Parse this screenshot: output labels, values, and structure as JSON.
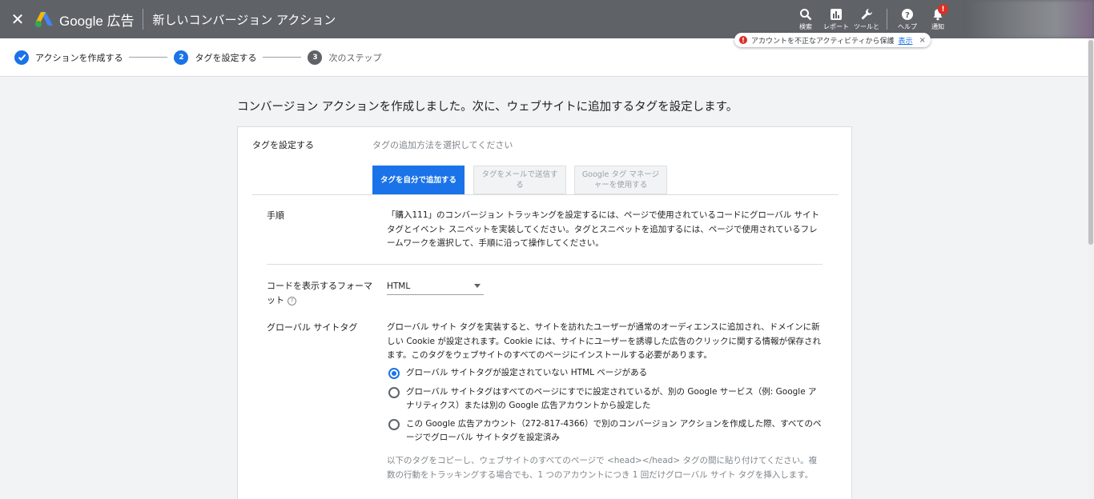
{
  "topbar": {
    "brand": "Google 広告",
    "page_title": "新しいコンバージョン アクション",
    "buttons": [
      {
        "label": "検索",
        "icon": "search-icon"
      },
      {
        "label": "レポート",
        "icon": "reports-icon"
      },
      {
        "label": "ツールと",
        "icon": "wrench-icon"
      },
      {
        "label": "ヘルプ",
        "icon": "help-icon"
      },
      {
        "label": "通知",
        "icon": "bell-icon"
      }
    ],
    "notification_badge": "!"
  },
  "toast": {
    "text": "アカウントを不正なアクティビティから保護",
    "link": "表示",
    "close": "×"
  },
  "stepper": {
    "steps": [
      {
        "number": "",
        "label": "アクションを作成する",
        "state": "done"
      },
      {
        "number": "2",
        "label": "タグを設定する",
        "state": "active"
      },
      {
        "number": "3",
        "label": "次のステップ",
        "state": "pending"
      }
    ]
  },
  "main": {
    "heading": "コンバージョン アクションを作成しました。次に、ウェブサイトに追加するタグを設定します。",
    "card": {
      "label": "タグを設定する",
      "subtitle": "タグの追加方法を選択してください",
      "tabs": [
        {
          "label": "タグを自分で追加する",
          "active": true
        },
        {
          "label": "タグをメールで送信する",
          "active": false
        },
        {
          "label": "Google タグ マネージャーを使用する",
          "active": false
        }
      ],
      "steps_label": "手順",
      "steps_text": "「購入111」のコンバージョン トラッキングを設定するには、ページで使用されているコードにグローバル サイトタグとイベント スニペットを実装してください。タグとスニペットを追加するには、ページで使用されているフレームワークを選択して、手順に沿って操作してください。",
      "format_label": "コードを表示するフォーマット",
      "format_value": "HTML",
      "global_tag_label": "グローバル サイトタグ",
      "global_tag_text": "グローバル サイト タグを実装すると、サイトを訪れたユーザーが通常のオーディエンスに追加され、ドメインに新しい Cookie が設定されます。Cookie には、サイトにユーザーを誘導した広告のクリックに関する情報が保存されます。このタグをウェブサイトのすべてのページにインストールする必要があります。",
      "options": [
        {
          "label": "グローバル サイトタグが設定されていない HTML ページがある",
          "selected": true
        },
        {
          "label": "グローバル サイトタグはすべてのページにすでに設定されているが、別の Google サービス（例: Google アナリティクス）または別の Google 広告アカウントから設定した",
          "selected": false
        },
        {
          "label": "この Google 広告アカウント（272-817-4366）で別のコンバージョン アクションを作成した際、すべてのページでグローバル サイトタグを設定済み",
          "selected": false
        }
      ],
      "note": "以下のタグをコピーし、ウェブサイトのすべてのページで <head></head> タグの間に貼り付けてください。複数の行動をトラッキングする場合でも、1 つのアカウントにつき 1 回だけグローバル サイト タグを挿入します。"
    }
  },
  "colors": {
    "topbar_bg": "#5f6368",
    "accent": "#1a73e8",
    "error": "#d93025"
  }
}
